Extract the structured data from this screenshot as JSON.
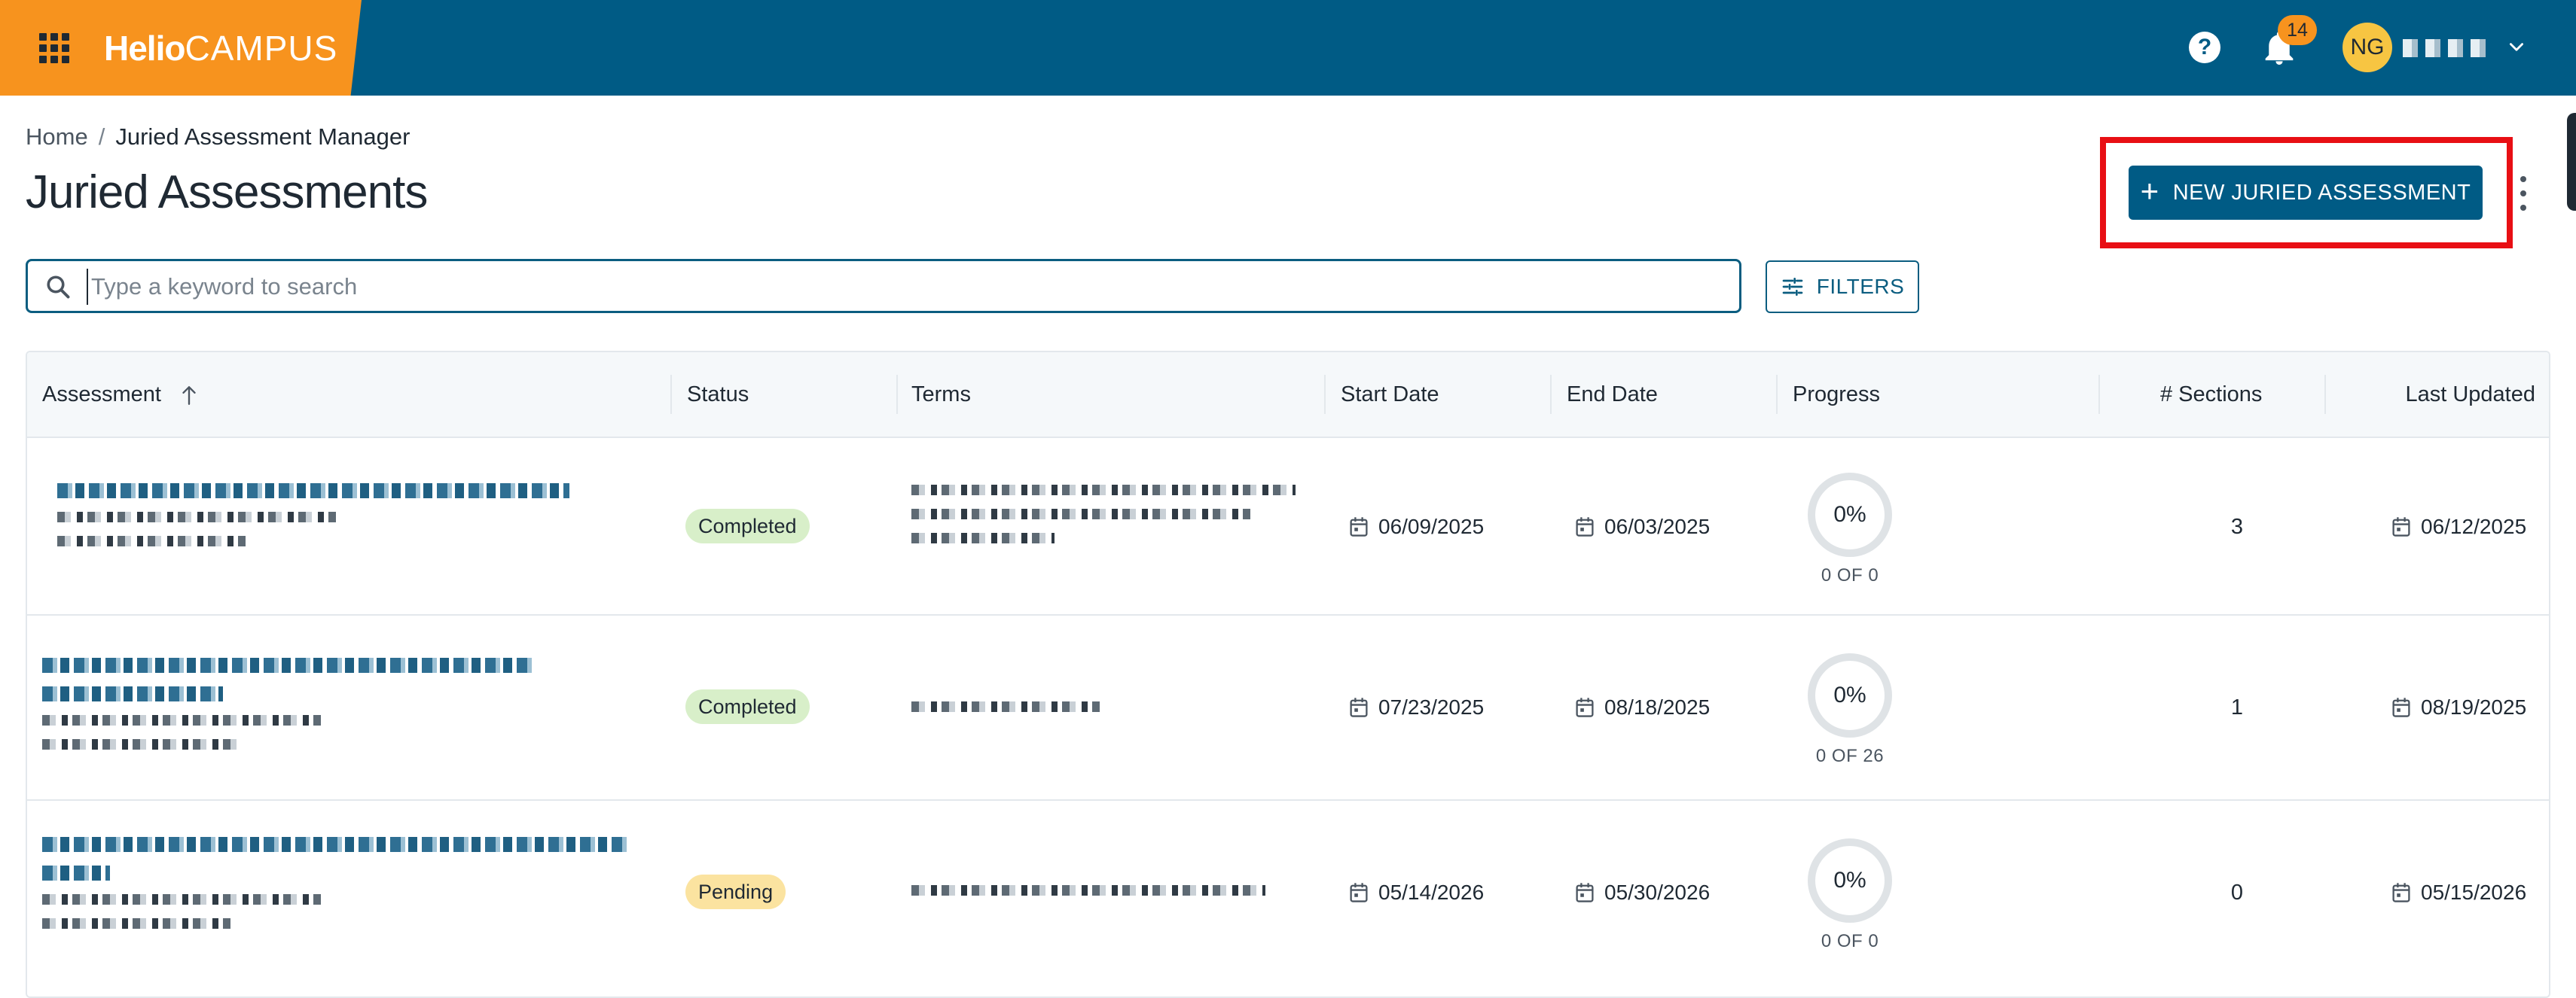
{
  "topbar": {
    "brand_bold": "Helio",
    "brand_light": "CAMPUS",
    "notification_count": "14",
    "user_initials": "NG",
    "colors": {
      "bar": "#005b85",
      "brand": "#f7931e",
      "avatar": "#f7c542"
    }
  },
  "breadcrumb": {
    "home": "Home",
    "separator": "/",
    "current": "Juried Assessment Manager"
  },
  "page": {
    "title": "Juried Assessments"
  },
  "actions": {
    "new_label": "NEW JURIED ASSESSMENT",
    "new_icon": "plus-icon",
    "more_icon": "more-vert-icon"
  },
  "search": {
    "placeholder": "Type a keyword to search",
    "value": ""
  },
  "filters": {
    "label": "FILTERS",
    "icon": "tune-icon"
  },
  "table": {
    "columns": [
      "Assessment",
      "Status",
      "Terms",
      "Start Date",
      "End Date",
      "Progress",
      "# Sections",
      "Last Updated"
    ],
    "sort": {
      "column": "Assessment",
      "direction": "ascending"
    },
    "rows": [
      {
        "status": "Completed",
        "start_date": "06/09/2025",
        "end_date": "06/03/2025",
        "progress_percent": "0%",
        "progress_caption": "0 OF 0",
        "sections": "3",
        "last_updated": "06/12/2025"
      },
      {
        "status": "Completed",
        "start_date": "07/23/2025",
        "end_date": "08/18/2025",
        "progress_percent": "0%",
        "progress_caption": "0 OF 26",
        "sections": "1",
        "last_updated": "08/19/2025"
      },
      {
        "status": "Pending",
        "start_date": "05/14/2026",
        "end_date": "05/30/2026",
        "progress_percent": "0%",
        "progress_caption": "0 OF 0",
        "sections": "0",
        "last_updated": "05/15/2026"
      }
    ],
    "status_colors": {
      "Completed": "#d8efc9",
      "Pending": "#fbe3a0"
    }
  }
}
